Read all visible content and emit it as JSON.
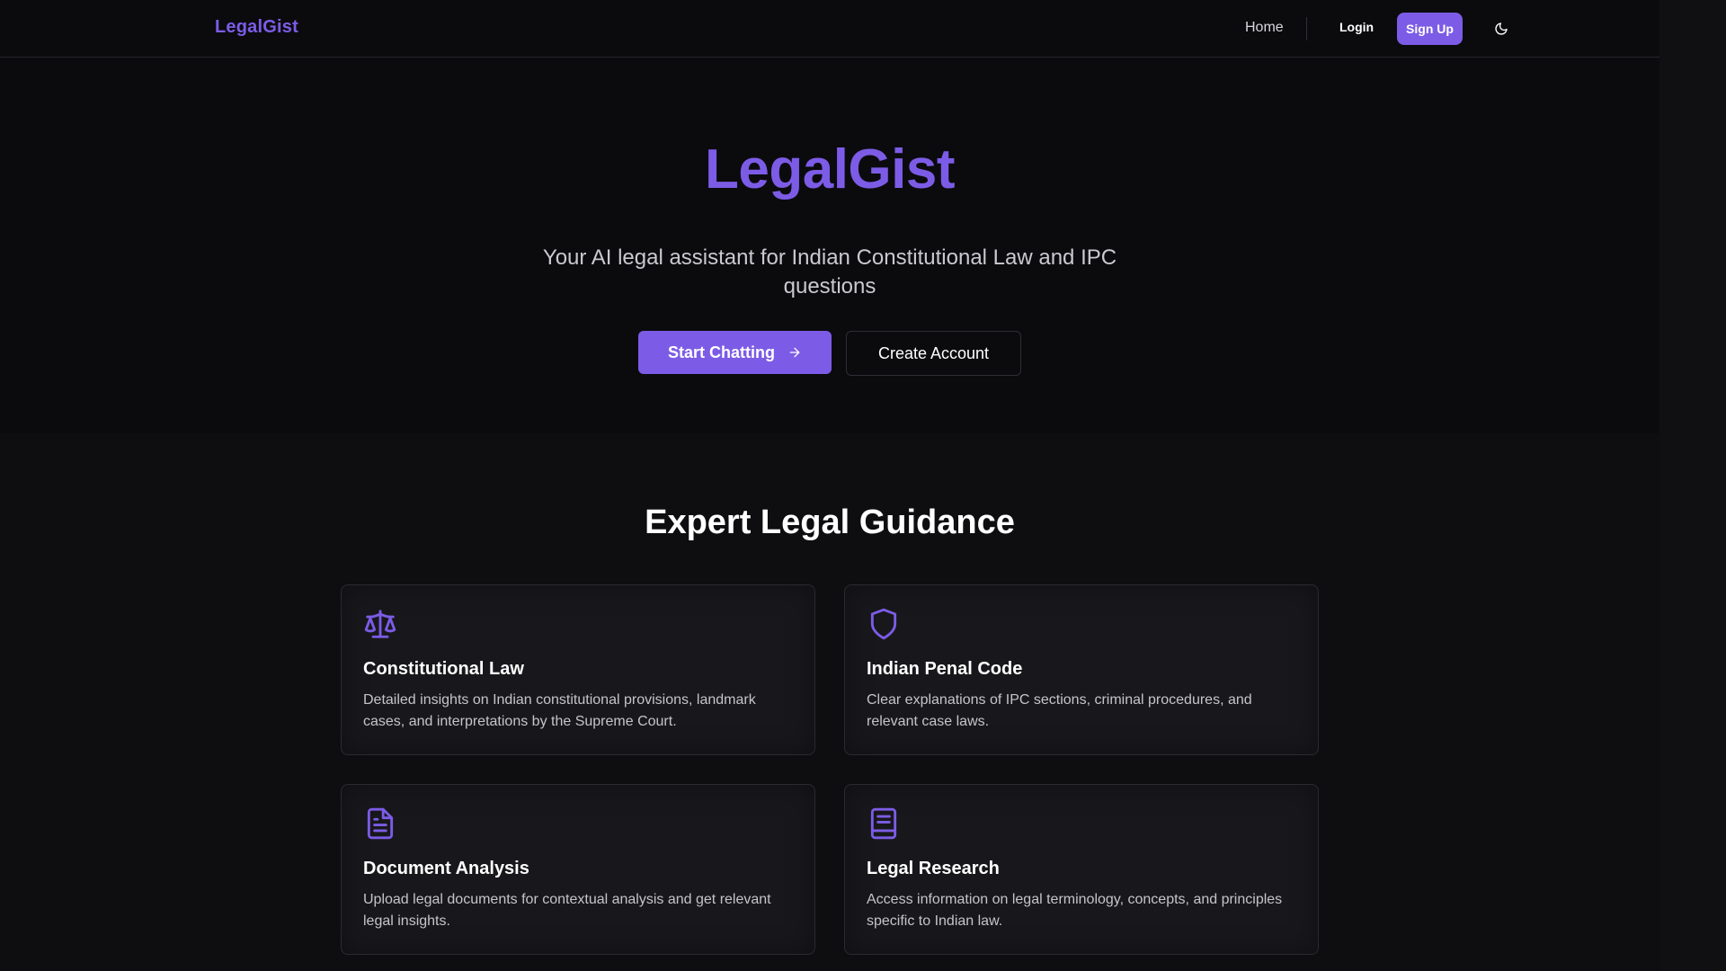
{
  "nav": {
    "brand": "LegalGist",
    "home": "Home",
    "login": "Login",
    "signup": "Sign Up",
    "theme_icon": "moon-icon"
  },
  "hero": {
    "title": "LegalGist",
    "subtitle": "Your AI legal assistant for Indian Constitutional Law and IPC questions",
    "primary_button": "Start Chatting",
    "primary_icon": "arrow-right-icon",
    "secondary_button": "Create Account"
  },
  "features": {
    "title": "Expert Legal Guidance",
    "cards": [
      {
        "icon": "scale-icon",
        "title": "Constitutional Law",
        "description": "Detailed insights on Indian constitutional provisions, landmark cases, and interpretations by the Supreme Court."
      },
      {
        "icon": "shield-icon",
        "title": "Indian Penal Code",
        "description": "Clear explanations of IPC sections, criminal procedures, and relevant case laws."
      },
      {
        "icon": "file-text-icon",
        "title": "Document Analysis",
        "description": "Upload legal documents for contextual analysis and get relevant legal insights."
      },
      {
        "icon": "book-icon",
        "title": "Legal Research",
        "description": "Access information on legal terminology, concepts, and principles specific to Indian law."
      }
    ]
  },
  "colors": {
    "accent": "#7c5ce6",
    "background": "#0b0b0e",
    "card": "#18181c"
  }
}
